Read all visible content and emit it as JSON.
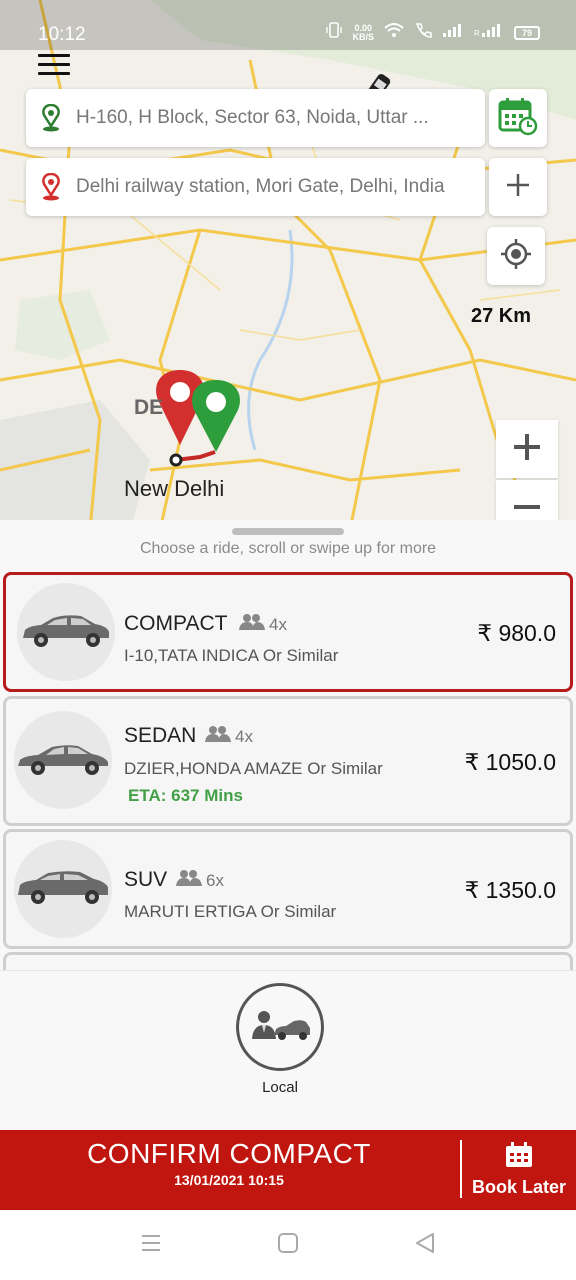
{
  "status_bar": {
    "time": "10:12",
    "speed": "0.00",
    "speed_unit": "KB/S",
    "battery": "79"
  },
  "search": {
    "pickup": "H-160, H Block, Sector 63, Noida, Uttar ...",
    "dropoff": "Delhi railway station, Mori Gate, Delhi, India"
  },
  "map": {
    "distance": "27 Km",
    "city_label": "New Delhi",
    "partial_label": "DE"
  },
  "sheet": {
    "hint": "Choose a ride, scroll or swipe up for more"
  },
  "rides": [
    {
      "name": "COMPACT",
      "seats": "4x",
      "desc": "I-10,TATA INDICA Or Similar",
      "price": "980.0",
      "currency": "₹",
      "eta": ""
    },
    {
      "name": "SEDAN",
      "seats": "4x",
      "desc": "DZIER,HONDA AMAZE Or Similar",
      "price": "1050.0",
      "currency": "₹",
      "eta": "ETA: 637 Mins"
    },
    {
      "name": "SUV",
      "seats": "6x",
      "desc": "MARUTI ERTIGA  Or Similar",
      "price": "1350.0",
      "currency": "₹",
      "eta": ""
    }
  ],
  "local": {
    "label": "Local"
  },
  "confirm": {
    "title": "CONFIRM COMPACT",
    "date": "13/01/2021 10:15",
    "book_later": "Book Later"
  },
  "colors": {
    "brand_red": "#c0160f",
    "eta_green": "#43a047",
    "pickup_green": "#2e7d32",
    "dropoff_red": "#d32f2f"
  },
  "icons": [
    "menu-icon",
    "pickup-pin-icon",
    "dropoff-pin-icon",
    "schedule-calendar-icon",
    "add-stop-icon",
    "my-location-icon",
    "zoom-in-icon",
    "zoom-out-icon",
    "people-icon",
    "car-icon",
    "chauffeur-car-icon",
    "calendar-icon",
    "recents-icon",
    "home-icon",
    "back-icon"
  ]
}
